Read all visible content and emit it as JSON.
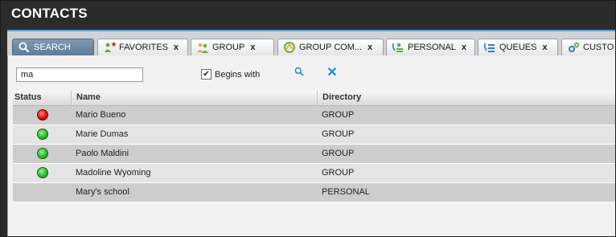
{
  "header": {
    "title": "CONTACTS"
  },
  "tabs": [
    {
      "label": "SEARCH",
      "icon": "search-icon",
      "closable": false,
      "active": true
    },
    {
      "label": "FAVORITES",
      "icon": "favorites-star-icon",
      "closable": true,
      "close": "x"
    },
    {
      "label": "GROUP",
      "icon": "group-icon",
      "closable": true,
      "close": "x"
    },
    {
      "label": "GROUP COM...",
      "icon": "group-common-icon",
      "closable": true,
      "close": "x"
    },
    {
      "label": "PERSONAL",
      "icon": "personal-icon",
      "closable": true,
      "close": "x"
    },
    {
      "label": "QUEUES",
      "icon": "queues-icon",
      "closable": true,
      "close": "x"
    },
    {
      "label": "CUSTO",
      "icon": "custom-icon",
      "closable": false
    }
  ],
  "search": {
    "value": "ma",
    "begins_with_label": "Begins with",
    "begins_with_checked": true,
    "checkmark": "✔",
    "clear_glyph": "✕"
  },
  "table": {
    "headers": {
      "status": "Status",
      "name": "Name",
      "directory": "Directory"
    },
    "rows": [
      {
        "status": "red",
        "name": "Mario Bueno",
        "directory": "GROUP"
      },
      {
        "status": "green",
        "name": "Marie Dumas",
        "directory": "GROUP"
      },
      {
        "status": "green",
        "name": "Paolo Maldini",
        "directory": "GROUP"
      },
      {
        "status": "green",
        "name": "Madoline Wyoming",
        "directory": "GROUP"
      },
      {
        "status": "none",
        "name": "Mary's school",
        "directory": "PERSONAL"
      }
    ]
  },
  "colors": {
    "title_bar": "#2b2b2b",
    "accent_line": "#5a9fd0",
    "active_tab": "#6d89a5",
    "status_available": "#2fc22f",
    "status_busy": "#e01515",
    "clear_icon": "#1e88d6"
  }
}
